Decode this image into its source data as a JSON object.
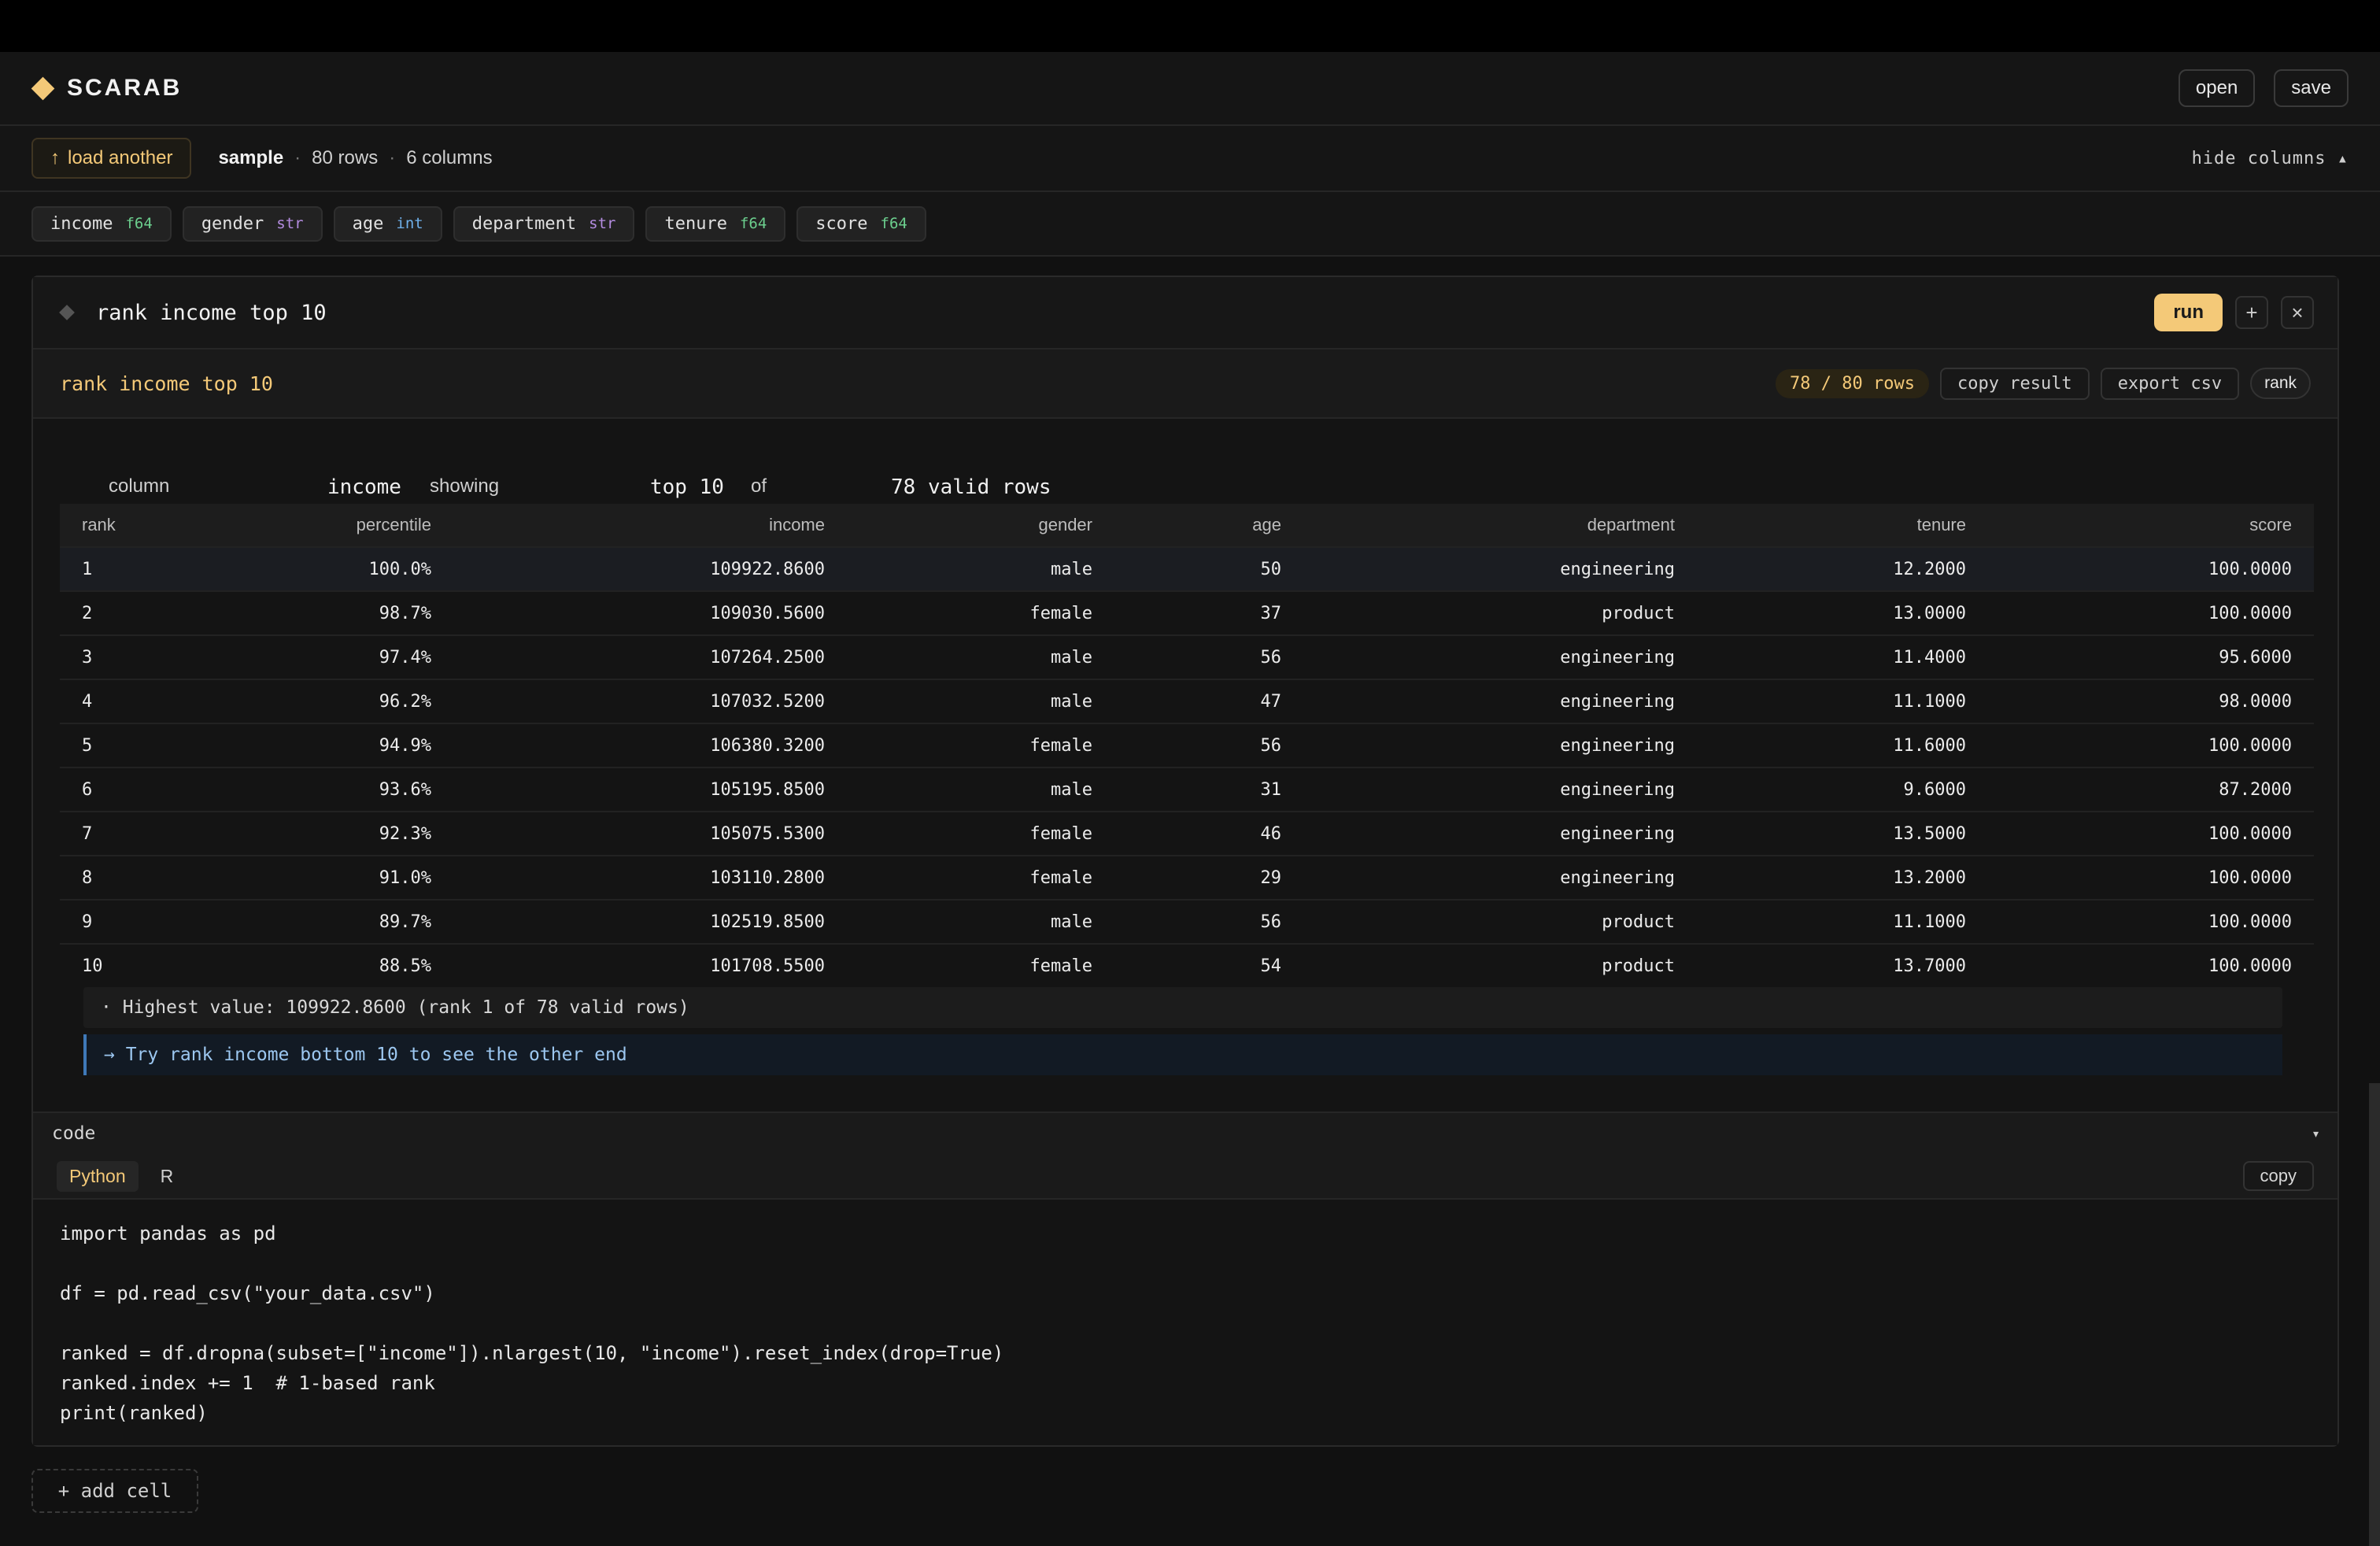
{
  "app": {
    "name": "SCARAB"
  },
  "header": {
    "open_label": "open",
    "save_label": "save"
  },
  "dataset": {
    "load_label": "load another",
    "name": "sample",
    "rows": "80 rows",
    "columns": "6 columns",
    "hide_label": "hide columns ▴"
  },
  "columns": [
    {
      "name": "income",
      "type": "f64"
    },
    {
      "name": "gender",
      "type": "str"
    },
    {
      "name": "age",
      "type": "int"
    },
    {
      "name": "department",
      "type": "str"
    },
    {
      "name": "tenure",
      "type": "f64"
    },
    {
      "name": "score",
      "type": "f64"
    }
  ],
  "cell": {
    "command": "rank income top 10",
    "run_label": "run",
    "add_icon": "+",
    "close_icon": "×"
  },
  "result": {
    "title": "rank income top 10",
    "rows_badge": "78 / 80 rows",
    "copy_label": "copy result",
    "export_label": "export csv",
    "mode_label": "rank",
    "params": {
      "column_label": "column",
      "column_value": "income",
      "showing_label": "showing",
      "showing_value": "top 10",
      "of_label": "of",
      "of_value": "78 valid rows"
    },
    "table": {
      "headers": [
        "rank",
        "percentile",
        "income",
        "gender",
        "age",
        "department",
        "tenure",
        "score"
      ],
      "rows": [
        [
          "1",
          "100.0%",
          "109922.8600",
          "male",
          "50",
          "engineering",
          "12.2000",
          "100.0000"
        ],
        [
          "2",
          "98.7%",
          "109030.5600",
          "female",
          "37",
          "product",
          "13.0000",
          "100.0000"
        ],
        [
          "3",
          "97.4%",
          "107264.2500",
          "male",
          "56",
          "engineering",
          "11.4000",
          "95.6000"
        ],
        [
          "4",
          "96.2%",
          "107032.5200",
          "male",
          "47",
          "engineering",
          "11.1000",
          "98.0000"
        ],
        [
          "5",
          "94.9%",
          "106380.3200",
          "female",
          "56",
          "engineering",
          "11.6000",
          "100.0000"
        ],
        [
          "6",
          "93.6%",
          "105195.8500",
          "male",
          "31",
          "engineering",
          "9.6000",
          "87.2000"
        ],
        [
          "7",
          "92.3%",
          "105075.5300",
          "female",
          "46",
          "engineering",
          "13.5000",
          "100.0000"
        ],
        [
          "8",
          "91.0%",
          "103110.2800",
          "female",
          "29",
          "engineering",
          "13.2000",
          "100.0000"
        ],
        [
          "9",
          "89.7%",
          "102519.8500",
          "male",
          "56",
          "product",
          "11.1000",
          "100.0000"
        ],
        [
          "10",
          "88.5%",
          "101708.5500",
          "female",
          "54",
          "product",
          "13.7000",
          "100.0000"
        ]
      ]
    },
    "note": "· Highest value: 109922.8600 (rank 1 of 78 valid rows)",
    "hint": "→ Try rank income bottom 10 to see the other end"
  },
  "code": {
    "section_label": "code",
    "caret": "▾",
    "languages": [
      "Python",
      "R"
    ],
    "copy_label": "copy",
    "source": "import pandas as pd\n\ndf = pd.read_csv(\"your_data.csv\")\n\nranked = df.dropna(subset=[\"income\"]).nlargest(10, \"income\").reset_index(drop=True)\nranked.index += 1  # 1-based rank\nprint(ranked)"
  },
  "footer": {
    "add_cell_label": "+ add cell"
  },
  "colors": {
    "accent": "#f4c978",
    "background": "#111111",
    "info": "#3f79b8"
  }
}
